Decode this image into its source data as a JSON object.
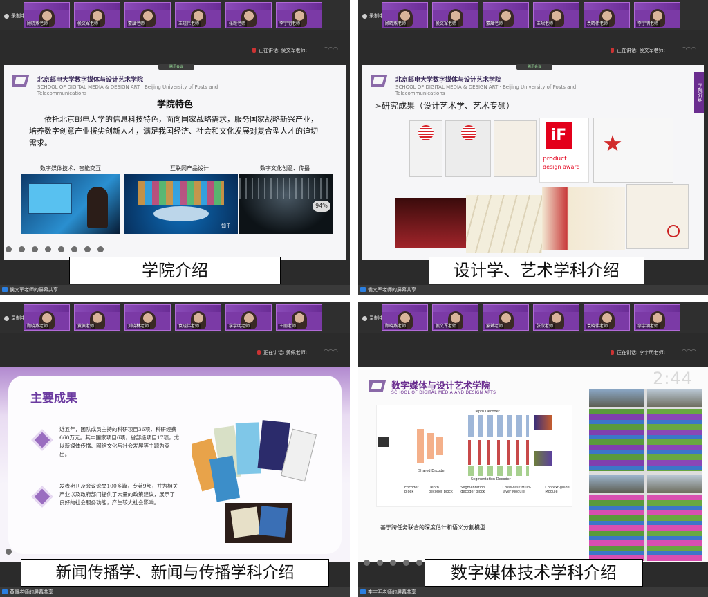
{
  "panels": [
    {
      "recording_label": "录制中",
      "speaking": "正在讲话: 侯文军老师;",
      "meeting_badge": "腾讯会议",
      "participants": [
        "顾晓燕老师",
        "侯文军老师",
        "蒙斌老师",
        "王晓伟老师",
        "张毅老师",
        "李宇明老师"
      ],
      "share_label": "侯文军老师的屏幕共享",
      "caption": "学院介绍"
    },
    {
      "recording_label": "录制中",
      "speaking": "正在讲话: 侯文军老师;",
      "meeting_badge": "腾讯会议",
      "participants": [
        "顾晓燕老师",
        "侯文军老师",
        "蒙斌老师",
        "王珺老师",
        "袁晓伟老师",
        "李宇明老师"
      ],
      "share_label": "侯文军老师的屏幕共享",
      "caption": "设计学、艺术学科介绍"
    },
    {
      "recording_label": "录制中",
      "speaking": "正在讲话: 黄佩老师;",
      "meeting_badge": "",
      "participants": [
        "顾晓燕老师",
        "黄佩老师",
        "刘晓林老师",
        "袁晓伟老师",
        "李宇明老师",
        "王丽老师"
      ],
      "share_label": "黄佩老师的屏幕共享",
      "caption": "新闻传播学、新闻与传播学科介绍"
    },
    {
      "recording_label": "录制中",
      "speaking": "正在讲话: 李宇明老师;",
      "meeting_badge": "",
      "participants": [
        "顾晓燕老师",
        "侯文军老师",
        "蒙斌老师",
        "张欣老师",
        "袁晓伟老师",
        "李宇明老师"
      ],
      "share_label": "李宇明老师的屏幕共享",
      "caption": "数字媒体技术学科介绍"
    }
  ],
  "slide1": {
    "school_cn": "北京邮电大学数字媒体与设计艺术学院",
    "school_en": "SCHOOL OF DIGITAL MEDIA & DESIGN ART · Beijing University of Posts and Telecommunications",
    "heading": "学院特色",
    "body": "依托北京邮电大学的信息科技特色，面向国家战略需求，服务国家战略新兴产业，培养数字创意产业拔尖创新人才，满足我国经济、社会和文化发展对复合型人才的迫切需求。",
    "labels": [
      "数字媒体技术、智能交互",
      "互联网产品设计",
      "数字文化创意、传播"
    ],
    "img_note": "知乎",
    "progress": "94%"
  },
  "slide2": {
    "school_cn": "北京邮电大学数字媒体与设计艺术学院",
    "school_en": "SCHOOL OF DIGITAL MEDIA & DESIGN ART · Beijing University of Posts and Telecommunications",
    "heading": "➢研究成果（设计艺术学、艺术专硕）",
    "if_line1": "product",
    "if_line2": "design award",
    "side_tab": "学院介绍"
  },
  "slide3": {
    "heading": "主要成果",
    "para1": "近五年，团队成员主持的科研项目36项，科研经费660万元。其中国家项目6项，省部级项目17项，尤以新媒体传播、网络文化与社会发展等主题为突出。",
    "para2": "发表期刊及会议论文100多篇，专著9部，并为相关产业以及政府部门提供了大量的政策建议，展示了良好的社会服务功能，产生较大社会影响。"
  },
  "slide4": {
    "clock": "2:44",
    "title": "数字媒体与设计艺术学院",
    "subtitle": "SCHOOL OF DIGITAL MEDIA AND DESIGN ARTS",
    "diagram_top": "Depth Decoder",
    "diagram_mid": "Segmentation Decoder",
    "diagram_left": "Shared Encoder",
    "legend": [
      "Encoder block",
      "Depth decoder block",
      "Segmentation decoder block",
      "Cross-task Multi-layer Module",
      "Context-guide Module"
    ],
    "caption": "基于跨任务联合的深度估计和语义分割模型"
  },
  "colors": {
    "purple": "#6a2d8f",
    "tile": "#7b3aa6"
  }
}
